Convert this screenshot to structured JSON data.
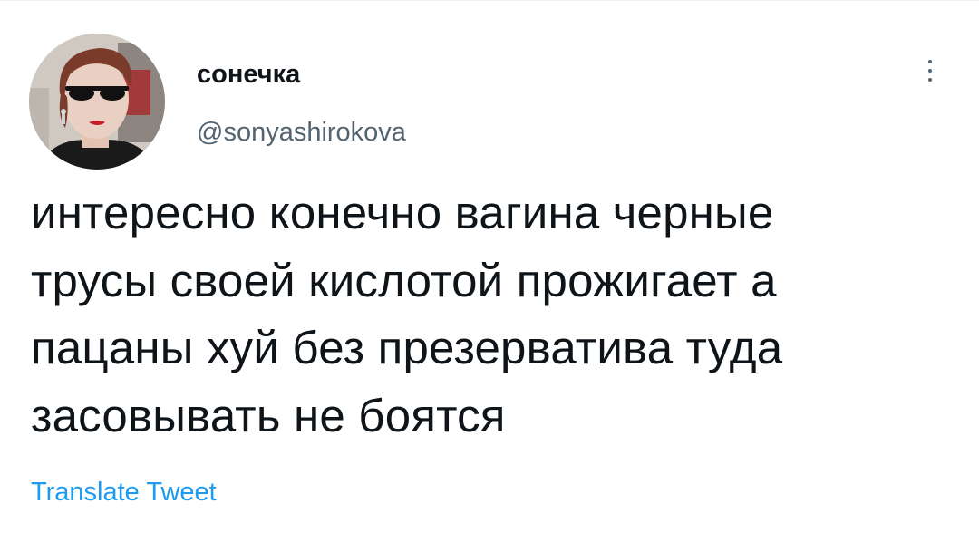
{
  "tweet": {
    "author": {
      "display_name": "сонечка",
      "handle": "@sonyashirokova",
      "avatar_icon": "avatar-photo"
    },
    "more_icon": "more-vertical-icon",
    "text_lines": [
      "интересно конечно вагина черные",
      "трусы своей кислотой прожигает а",
      "пацаны хуй без презерватива туда",
      "засовывать не боятся"
    ],
    "translate_label": "Translate Tweet"
  },
  "colors": {
    "text": "#0f1419",
    "secondary": "#536471",
    "link": "#1d9bf0"
  }
}
